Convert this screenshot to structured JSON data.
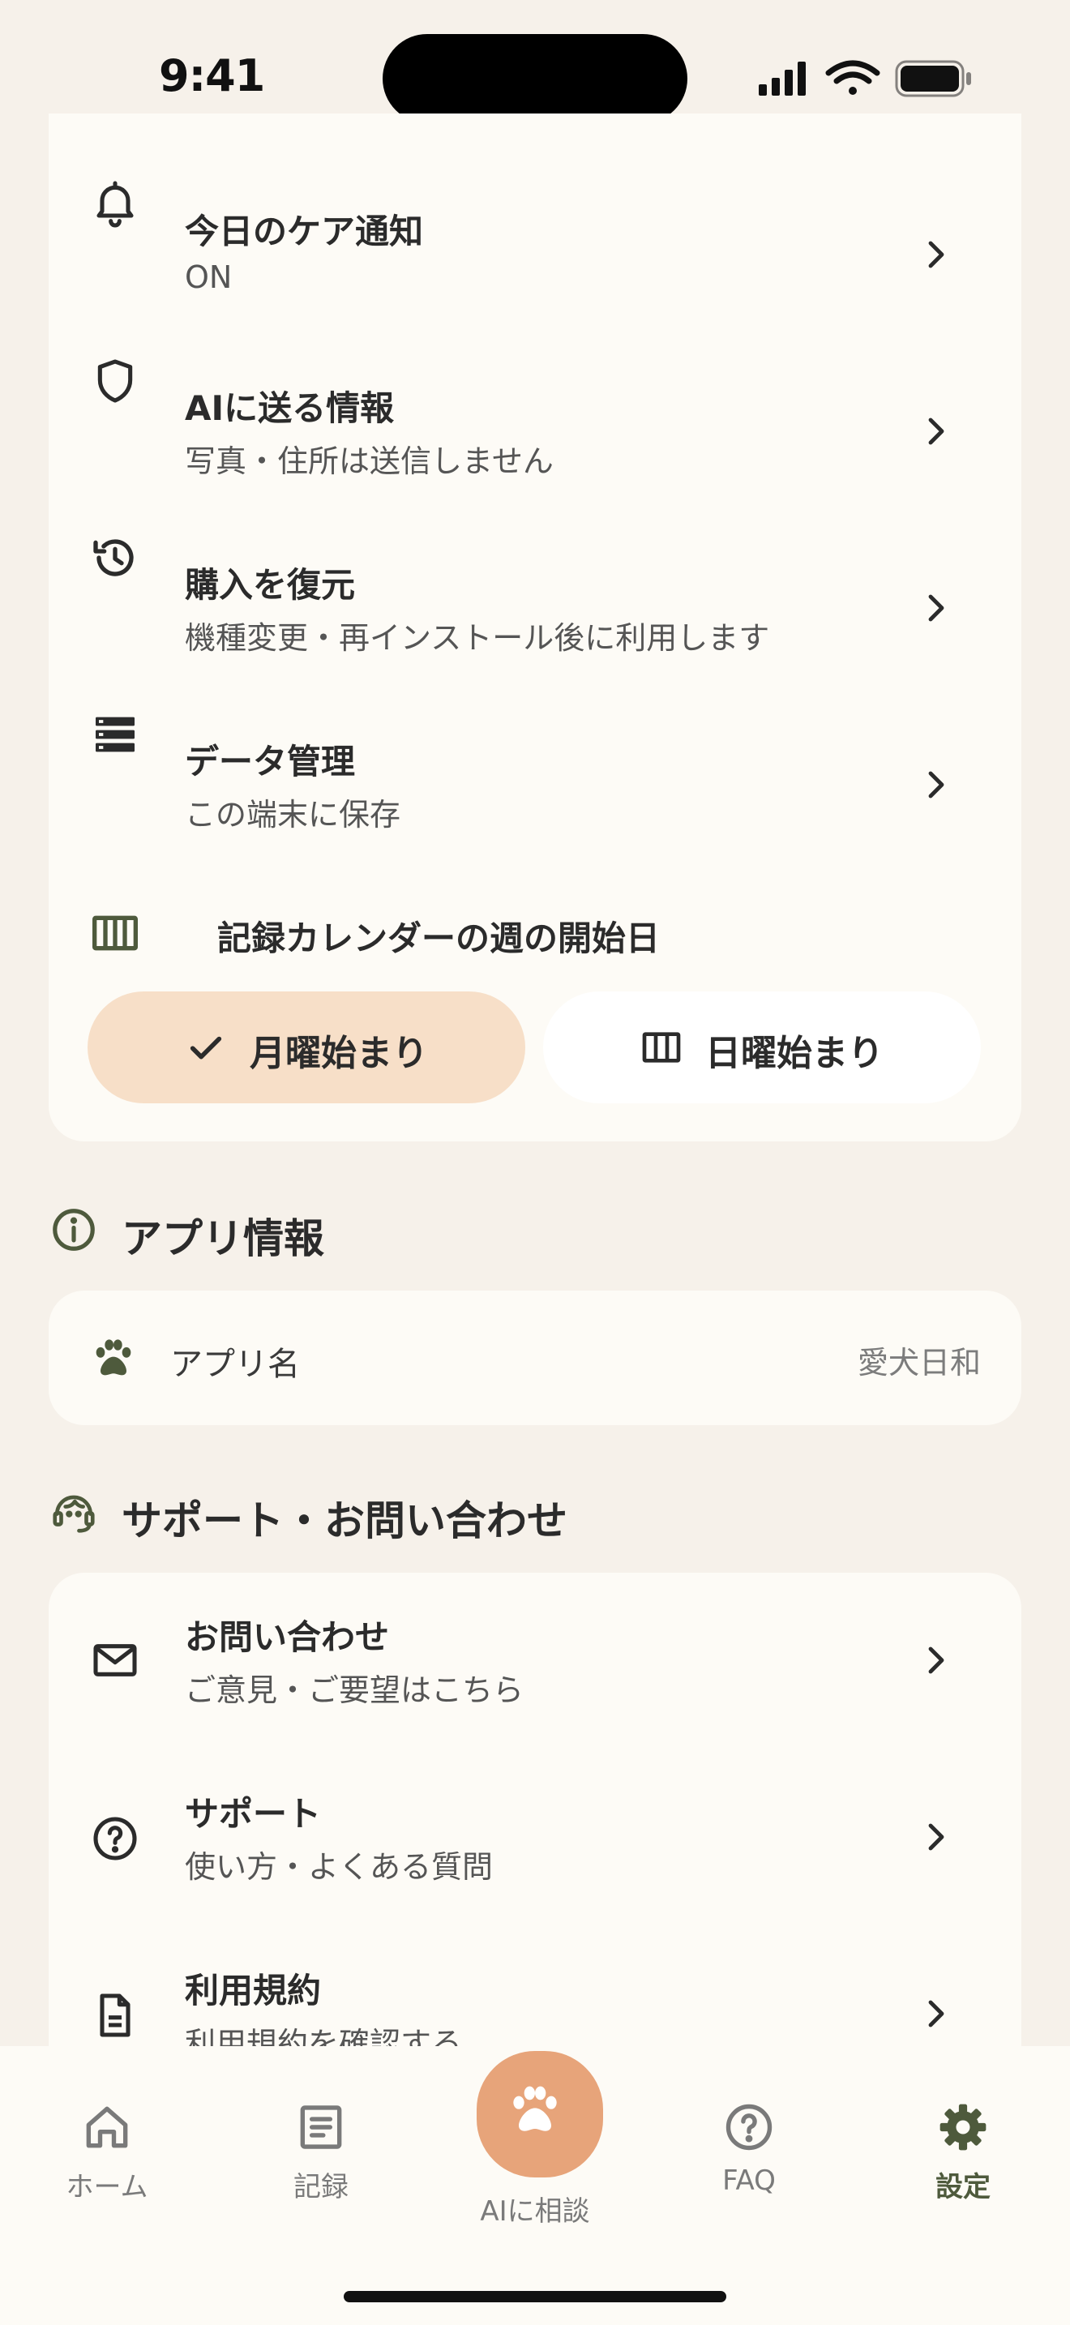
{
  "status_bar": {
    "time": "9:41"
  },
  "settings_rows": [
    {
      "title": "今日のケア通知",
      "subtitle": "ON",
      "icon": "bell-icon"
    },
    {
      "title": "AIに送る情報",
      "subtitle": "写真・住所は送信しません",
      "icon": "shield-icon"
    },
    {
      "title": "購入を復元",
      "subtitle": "機種変更・再インストール後に利用します",
      "icon": "restore-history-icon"
    },
    {
      "title": "データ管理",
      "subtitle": "この端末に保存",
      "icon": "storage-icon"
    }
  ],
  "calendar_setting": {
    "heading": "記録カレンダーの週の開始日",
    "options": [
      {
        "label": "月曜始まり",
        "selected": true
      },
      {
        "label": "日曜始まり",
        "selected": false
      }
    ]
  },
  "app_info": {
    "heading": "アプリ情報",
    "name_label": "アプリ名",
    "name_value": "愛犬日和"
  },
  "support": {
    "heading": "サポート・お問い合わせ",
    "rows": [
      {
        "title": "お問い合わせ",
        "subtitle": "ご意見・ご要望はこちら",
        "icon": "mail-icon"
      },
      {
        "title": "サポート",
        "subtitle": "使い方・よくある質問",
        "icon": "help-icon"
      },
      {
        "title": "利用規約",
        "subtitle": "利用規約を確認する",
        "icon": "document-icon"
      }
    ]
  },
  "tab_bar": {
    "home": "ホーム",
    "records": "記録",
    "ai": "AIに相談",
    "faq": "FAQ",
    "settings": "設定",
    "active": "settings"
  },
  "colors": {
    "background": "#f6f1ea",
    "card": "#fdfbf6",
    "accent_orange": "#e7a47a",
    "selected_segment": "#f7dfc8",
    "olive": "#4e5a3c"
  }
}
